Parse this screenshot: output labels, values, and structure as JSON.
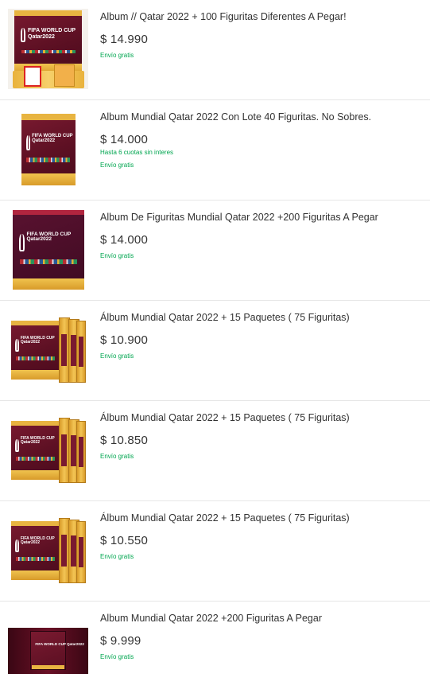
{
  "listings": [
    {
      "title": "Album // Qatar 2022 + 100 Figuritas Diferentes A Pegar!",
      "price": "$ 14.990",
      "installments": "",
      "shipping": "Envío gratis",
      "image_logo": "FIFA WORLD CUP Qatar2022",
      "image_icon": "album-with-stickers-image"
    },
    {
      "title": "Album Mundial Qatar 2022 Con Lote 40 Figuritas. No Sobres.",
      "price": "$ 14.000",
      "installments": "Hasta 6 cuotas sin interes",
      "shipping": "Envío gratis",
      "image_logo": "FIFA WORLD CUP Qatar2022",
      "image_icon": "album-cover-image"
    },
    {
      "title": "Album De Figuritas Mundial Qatar 2022 +200 Figuritas A Pegar",
      "price": "$ 14.000",
      "installments": "",
      "shipping": "Envío gratis",
      "image_logo": "FIFA WORLD CUP Qatar2022",
      "image_icon": "album-cover-image"
    },
    {
      "title": "Álbum Mundial Qatar 2022 + 15 Paquetes ( 75 Figuritas)",
      "price": "$ 10.900",
      "installments": "",
      "shipping": "Envío gratis",
      "image_logo": "FIFA WORLD CUP Qatar2022",
      "image_icon": "album-with-packs-image"
    },
    {
      "title": "Álbum Mundial Qatar 2022 + 15 Paquetes ( 75 Figuritas)",
      "price": "$ 10.850",
      "installments": "",
      "shipping": "Envío gratis",
      "image_logo": "FIFA WORLD CUP Qatar2022",
      "image_icon": "album-with-packs-image"
    },
    {
      "title": "Álbum Mundial Qatar 2022 + 15 Paquetes ( 75 Figuritas)",
      "price": "$ 10.550",
      "installments": "",
      "shipping": "Envío gratis",
      "image_logo": "FIFA WORLD CUP Qatar2022",
      "image_icon": "album-with-packs-image"
    },
    {
      "title": "Album Mundial Qatar 2022 +200 Figuritas A Pegar",
      "price": "$ 9.999",
      "installments": "",
      "shipping": "Envío gratis",
      "image_logo": "FIFA WORLD CUP Qatar2022",
      "image_icon": "album-cover-image"
    }
  ],
  "colors": {
    "text": "#333333",
    "free_shipping": "#00a650",
    "album_maroon": "#5a0f22",
    "album_gold": "#e8b441",
    "divider": "#e6e6e6"
  }
}
